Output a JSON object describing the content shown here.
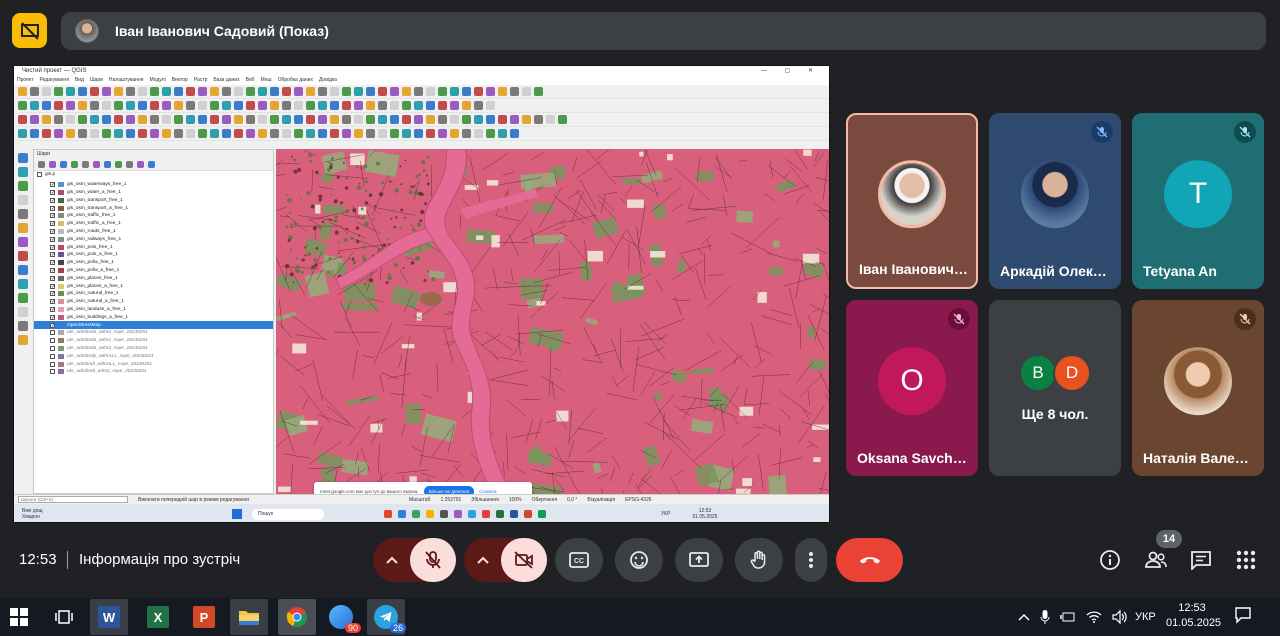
{
  "presenter_banner": {
    "name": "Іван Іванович Садовий (Показ)"
  },
  "shared_screen": {
    "window_title": "Чистий проект — QGIS",
    "menu": [
      "Проект",
      "Редагування",
      "Вид",
      "Шари",
      "Налаштування",
      "Модулі",
      "Вектор",
      "Растр",
      "База даних",
      "Веб",
      "Меш",
      "Обробка даних",
      "Довідка"
    ],
    "panel_title": "Шари",
    "layers": [
      {
        "label": "gis_osm_waterways_free_1",
        "color": "#5a8fd1",
        "checked": true
      },
      {
        "label": "gis_osm_water_a_free_1",
        "color": "#b3477a",
        "checked": true
      },
      {
        "label": "gis_osm_transport_free_1",
        "color": "#3f6b3a",
        "checked": true
      },
      {
        "label": "gis_osm_transport_a_free_1",
        "color": "#8a5a3a",
        "checked": true
      },
      {
        "label": "gis_osm_traffic_free_1",
        "color": "#888888",
        "checked": true
      },
      {
        "label": "gis_osm_traffic_a_free_1",
        "color": "#d9b96a",
        "checked": true
      },
      {
        "label": "gis_osm_roads_free_1",
        "color": "#bbbbbb",
        "checked": true
      },
      {
        "label": "gis_osm_railways_free_1",
        "color": "#888888",
        "checked": true
      },
      {
        "label": "gis_osm_pois_free_1",
        "color": "#c04a6a",
        "checked": true
      },
      {
        "label": "gis_osm_pois_a_free_1",
        "color": "#7a4a9a",
        "checked": true
      },
      {
        "label": "gis_osm_pofw_free_1",
        "color": "#444444",
        "checked": true
      },
      {
        "label": "gis_osm_pofw_a_free_1",
        "color": "#a04040",
        "checked": true
      },
      {
        "label": "gis_osm_places_free_1",
        "color": "#666666",
        "checked": true
      },
      {
        "label": "gis_osm_places_a_free_1",
        "color": "#cfcf7a",
        "checked": true
      },
      {
        "label": "gis_osm_natural_free_1",
        "color": "#5a9a4a",
        "checked": true
      },
      {
        "label": "gis_osm_natural_a_free_1",
        "color": "#d98aa6",
        "checked": true
      },
      {
        "label": "gis_osm_landuse_a_free_1",
        "color": "#e59ab0",
        "checked": true
      },
      {
        "label": "gis_osm_buildings_a_free_1",
        "color": "#c2587a",
        "checked": true
      },
      {
        "label": "OpenStreetMap",
        "color": "#2f7fd8",
        "checked": true,
        "selected": true
      },
      {
        "label": "ukr_admbnda_adm0_sspe_20230201",
        "color": "#aaaaaa",
        "checked": false,
        "grey": true
      },
      {
        "label": "ukr_admbnda_adm1_sspe_20230201",
        "color": "#9a7a5a",
        "checked": false,
        "grey": true
      },
      {
        "label": "ukr_admbnda_adm2_sspe_20230201",
        "color": "#7a9a7a",
        "checked": false,
        "grey": true
      },
      {
        "label": "ukr_admbndp_admALL_sspe_20230201",
        "color": "#7a7aaa",
        "checked": false,
        "grey": true
      },
      {
        "label": "ukr_admbndl_admALL_sspe_20230201",
        "color": "#aa7a7a",
        "checked": false,
        "grey": true
      },
      {
        "label": "ukr_admbndt_adm2_sspe_20230201",
        "color": "#8a6aaa",
        "checked": false,
        "grey": true
      }
    ],
    "status": {
      "search_placeholder": "Шукати (Ctrl+K)",
      "message": "Виконати попередній шар в режим редагування",
      "scale_label": "Масштаб",
      "scale_value": "1:253791",
      "magnifier_label": "Збільшення",
      "magnifier_value": "100%",
      "rotation_label": "Обертання",
      "rotation_value": "0,0 °",
      "render_label": "Візуалізація",
      "crs": "EPSG:4326"
    },
    "notice": {
      "text": "meet.google.com має доступ до вашого екрана.",
      "button": "Більше не ділитися",
      "link": "Сховати"
    },
    "inner_taskbar": {
      "weather_line1": "Вже дощ",
      "weather_line2": "Хмарно",
      "search": "Пошук",
      "lang": "УКР",
      "time": "12:53",
      "date": "01.05.2025"
    }
  },
  "participants": [
    {
      "name": "Іван Іванович Садовий",
      "bg": "#7a4a3e",
      "avatar": "photo1",
      "active": true,
      "muted": false
    },
    {
      "name": "Аркадій Олександрович",
      "bg": "#2e4a6e",
      "avatar": "photo2",
      "muted": true
    },
    {
      "name": "Tetyana An",
      "bg": "#1f6e74",
      "letter": "T",
      "letter_bg": "#11a6b6",
      "muted": true
    },
    {
      "name": "Oksana Savchuk",
      "bg": "#8a1a4e",
      "letter": "O",
      "letter_bg": "#c2185b",
      "muted": true
    },
    {
      "more_label": "Ще 8 чол.",
      "mini": [
        {
          "letter": "B",
          "bg": "#0b8043"
        },
        {
          "letter": "D",
          "bg": "#e8521f"
        }
      ]
    },
    {
      "name": "Наталія Валеріївна",
      "bg": "#6a4630",
      "avatar": "photo3",
      "muted": true
    }
  ],
  "controls": {
    "clock": "12:53",
    "meeting_info": "Інформація про зустріч",
    "people_count": "14"
  },
  "taskbar": {
    "lang": "УКР",
    "time": "12:53",
    "date": "01.05.2025",
    "badges": {
      "yandex": "90",
      "telegram": "26"
    }
  },
  "colors": {
    "end_call": "#ea4335",
    "muted_ctrl": "#f9dedc",
    "muted_ctrl_dark": "#5c1a16",
    "map_pink": "#d9607c"
  }
}
